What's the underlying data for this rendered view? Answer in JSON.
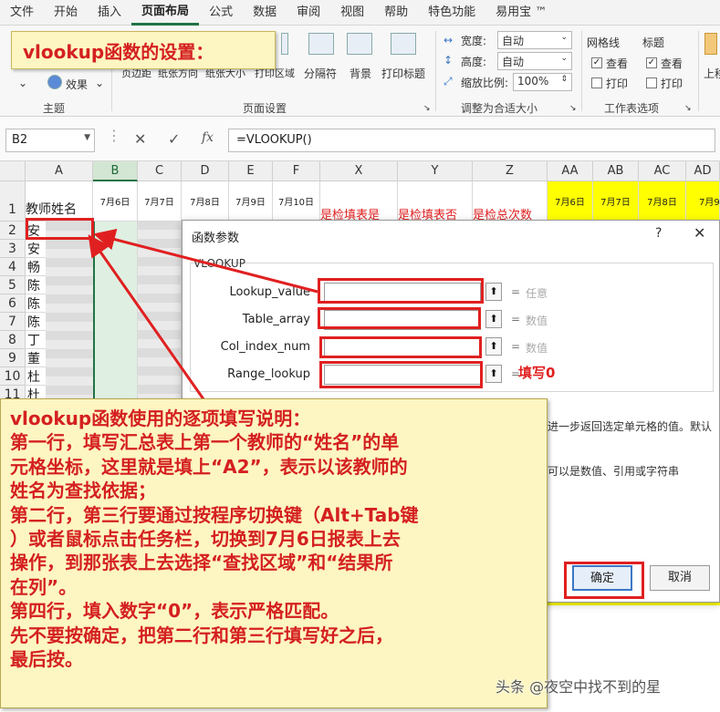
{
  "menu": [
    "文件",
    "开始",
    "插入",
    "页面布局",
    "公式",
    "数据",
    "审阅",
    "视图",
    "帮助",
    "特色功能",
    "易用宝 ™"
  ],
  "ribbon": {
    "effects_label": "效果",
    "theme_group": "主题",
    "page_setup_items": [
      "页边距",
      "纸张方向",
      "纸张大小",
      "打印区域",
      "分隔符",
      "背景",
      "打印标题"
    ],
    "page_setup_group": "页面设置",
    "width_label": "宽度:",
    "width_value": "自动",
    "height_label": "高度:",
    "height_value": "自动",
    "scale_label": "缩放比例:",
    "scale_value": "100%",
    "fit_group": "调整为合适大小",
    "gridlines_label": "网格线",
    "headings_label": "标题",
    "view_label": "查看",
    "print_label": "打印",
    "sheet_options_group": "工作表选项",
    "arrange_label": "上移"
  },
  "formula_bar": {
    "name_box": "B2",
    "cancel": "✕",
    "enter": "✓",
    "fx": "fx",
    "formula": "=VLOOKUP()"
  },
  "sheet": {
    "columns": [
      "A",
      "B",
      "C",
      "D",
      "E",
      "F",
      "X",
      "Y",
      "Z",
      "AA",
      "AB",
      "AC",
      "AD"
    ],
    "header_row": [
      "教师姓名",
      "7月6日",
      "7月7日",
      "7月8日",
      "7月9日",
      "7月10日",
      "是检填表是",
      "是检填表否",
      "是检总次数",
      "7月6日",
      "7月7日",
      "7月8日",
      "7月9"
    ],
    "row_numbers": [
      "1",
      "2",
      "3",
      "4",
      "5",
      "6",
      "7",
      "8",
      "9",
      "10",
      "11"
    ],
    "col_a_values": [
      "",
      "安",
      "安",
      "畅",
      "陈",
      "陈",
      "陈",
      "丁",
      "董",
      "杜",
      "杜"
    ]
  },
  "dialog": {
    "title": "函数参数",
    "help": "?",
    "close": "✕",
    "func_name": "VLOOKUP",
    "args": [
      {
        "label": "Lookup_value",
        "hint": "任意"
      },
      {
        "label": "Table_array",
        "hint": "数值"
      },
      {
        "label": "Col_index_num",
        "hint": "数值"
      },
      {
        "label": "Range_lookup",
        "hint": ""
      }
    ],
    "eq": "=",
    "desc1": "进一步返回选定单元格的值。默认",
    "desc2": "可以是数值、引用或字符串",
    "ok": "确定",
    "cancel": "取消"
  },
  "annotations": {
    "fill_zero": "填写0",
    "title_callout": "vlookup函数的设置：",
    "main_callout": [
      "vlookup函数使用的逐项填写说明：",
      "第一行，填写汇总表上第一个教师的“姓名”的单",
      "元格坐标，这里就是填上“A2”，表示以该教师的",
      "姓名为查找依据；",
      "第二行，第三行要通过按程序切换键（Alt+Tab键",
      "）或者鼠标点击任务栏，切换到7月6日报表上去",
      "操作，到那张表上去选择“查找区域”和“结果所",
      "在列”。",
      "第四行，填入数字“0”，表示严格匹配。",
      "先不要按确定，把第二行和第三行填写好之后，",
      "最后按。"
    ]
  },
  "watermark": "头条 @夜空中找不到的星",
  "colors": {
    "accent": "#217346",
    "annotation_red": "#e02020",
    "note_bg": "#fdf6c2",
    "highlight_yellow": "#ffff00"
  }
}
